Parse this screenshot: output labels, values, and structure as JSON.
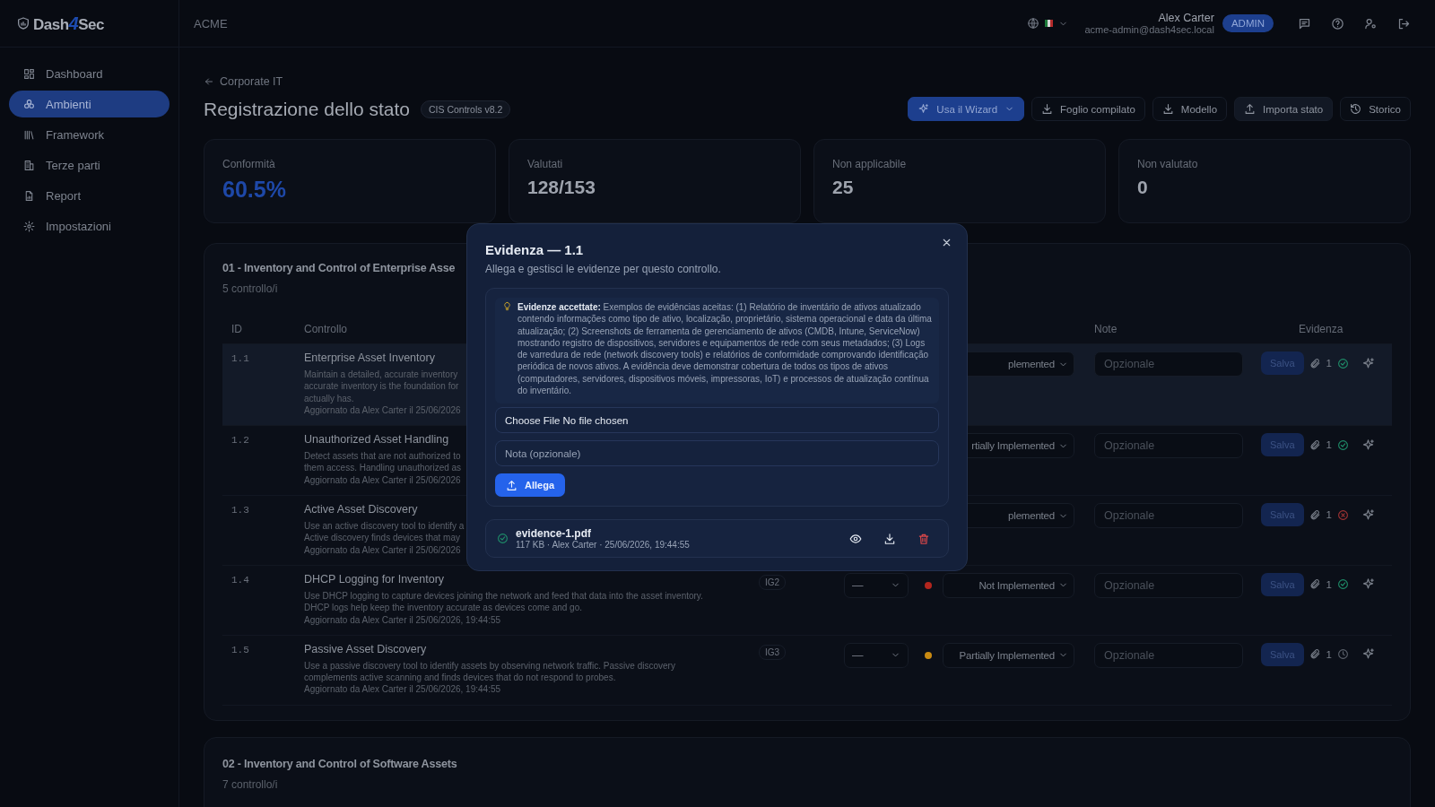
{
  "logo": {
    "before": "Dash",
    "mark": "4",
    "after": "Sec"
  },
  "sidebar": {
    "items": [
      {
        "label": "Dashboard",
        "selected": false
      },
      {
        "label": "Ambienti",
        "selected": true
      },
      {
        "label": "Framework",
        "selected": false
      },
      {
        "label": "Terze parti",
        "selected": false
      },
      {
        "label": "Report",
        "selected": false
      },
      {
        "label": "Impostazioni",
        "selected": false
      }
    ]
  },
  "topbar": {
    "org": "ACME",
    "user": {
      "name": "Alex Carter",
      "email": "acme-admin@dash4sec.local",
      "role": "ADMIN"
    }
  },
  "page": {
    "back": "Corporate IT",
    "title": "Registrazione dello stato",
    "badge": "CIS Controls v8.2",
    "actions": [
      {
        "label": "Usa il Wizard",
        "kind": "primary"
      },
      {
        "label": "Foglio compilato",
        "kind": "outline"
      },
      {
        "label": "Modello",
        "kind": "outline"
      },
      {
        "label": "Importa stato",
        "kind": "soft"
      },
      {
        "label": "Storico",
        "kind": "outline"
      }
    ]
  },
  "stats": [
    {
      "label": "Conformità",
      "value": "60.5%",
      "kind": "accent"
    },
    {
      "label": "Valutati",
      "value": "128/153",
      "kind": "plain"
    },
    {
      "label": "Non applicabile",
      "value": "25",
      "kind": "plain"
    },
    {
      "label": "Non valutato",
      "value": "0",
      "kind": "plain"
    }
  ],
  "section": {
    "title": "01 - Inventory and Control of Enterprise Asse",
    "count": "5 controllo/i",
    "columns": {
      "id": "ID",
      "control": "Controllo",
      "note": "Note",
      "evidence": "Evidenza"
    },
    "rows": [
      {
        "id": "1.1",
        "title": "Enterprise Asset Inventory",
        "description": [
          "Maintain a detailed, accurate inventory",
          "accurate inventory is the foundation for",
          "actually has."
        ],
        "updated": "Aggiornato da Alex Carter il 25/06/2026",
        "status": "plemented",
        "note_placeholder": "Opzionale",
        "save": "Salva",
        "attachments": "1",
        "verified": true,
        "rejected": false,
        "selected": true
      },
      {
        "id": "1.2",
        "title": "Unauthorized Asset Handling",
        "description": [
          "Detect assets that are not authorized to",
          "them access. Handling unauthorized as"
        ],
        "updated": "Aggiornato da Alex Carter il 25/06/2026",
        "status": "rtially Implemented",
        "note_placeholder": "Opzionale",
        "save": "Salva",
        "attachments": "1",
        "verified": true,
        "rejected": false,
        "selected": false
      },
      {
        "id": "1.3",
        "title": "Active Asset Discovery",
        "description": [
          "Use an active discovery tool to identify a",
          "Active discovery finds devices that may"
        ],
        "updated": "Aggiornato da Alex Carter il 25/06/2026",
        "status": "plemented",
        "note_placeholder": "Opzionale",
        "save": "Salva",
        "attachments": "1",
        "verified": false,
        "rejected": true,
        "selected": false
      },
      {
        "id": "1.4",
        "title": "DHCP Logging for Inventory",
        "description": [
          "Use DHCP logging to capture devices joining the network and feed that data into the asset inventory.",
          "DHCP logs help keep the inventory accurate as devices come and go."
        ],
        "updated": "Aggiornato da Alex Carter il 25/06/2026, 19:44:55",
        "ig": "IG2",
        "level": "—",
        "color": "#b3261e",
        "status": "Not Implemented",
        "note_placeholder": "Opzionale",
        "save": "Salva",
        "attachments": "1",
        "verified": true,
        "rejected": false,
        "selected": false
      },
      {
        "id": "1.5",
        "title": "Passive Asset Discovery",
        "description": [
          "Use a passive discovery tool to identify assets by observing network traffic. Passive discovery",
          "complements active scanning and finds devices that do not respond to probes."
        ],
        "updated": "Aggiornato da Alex Carter il 25/06/2026, 19:44:55",
        "ig": "IG3",
        "level": "—",
        "color": "#c98a12",
        "status": "Partially Implemented",
        "note_placeholder": "Opzionale",
        "save": "Salva",
        "attachments": "1",
        "verified": false,
        "rejected": false,
        "selected": false
      }
    ]
  },
  "next_section": {
    "title": "02 - Inventory and Control of Software Assets",
    "count": "7 controllo/i"
  },
  "modal": {
    "title": "Evidenza — 1.1",
    "subtitle": "Allega e gestisci le evidenze per questo controllo.",
    "hint": "**Evidenze accettate:** Exemplos de evidências aceitas: (1) Relatório de inventário de ativos atualizado contendo informações como tipo de ativo, localização, proprietário, sistema operacional e data da última atualização; (2) Screenshots de ferramenta de gerenciamento de ativos (CMDB, Intune, ServiceNow) mostrando registro de dispositivos, servidores e equipamentos de rede com seus metadados; (3) Logs de varredura de rede (network discovery tools) e relatórios de conformidade comprovando identificação periódica de novos ativos. A evidência deve demonstrar cobertura de todos os tipos de ativos (computadores, servidores, dispositivos móveis, impressoras, IoT) e processos de atualização contínua do inventário.",
    "file_field": "Choose File No file chosen",
    "note_placeholder": "Nota (opzionale)",
    "attach": "Allega",
    "files": [
      {
        "name": "evidence-1.pdf",
        "meta": "117 KB · Alex Carter · 25/06/2026, 19:44:55",
        "verified": true
      }
    ]
  }
}
